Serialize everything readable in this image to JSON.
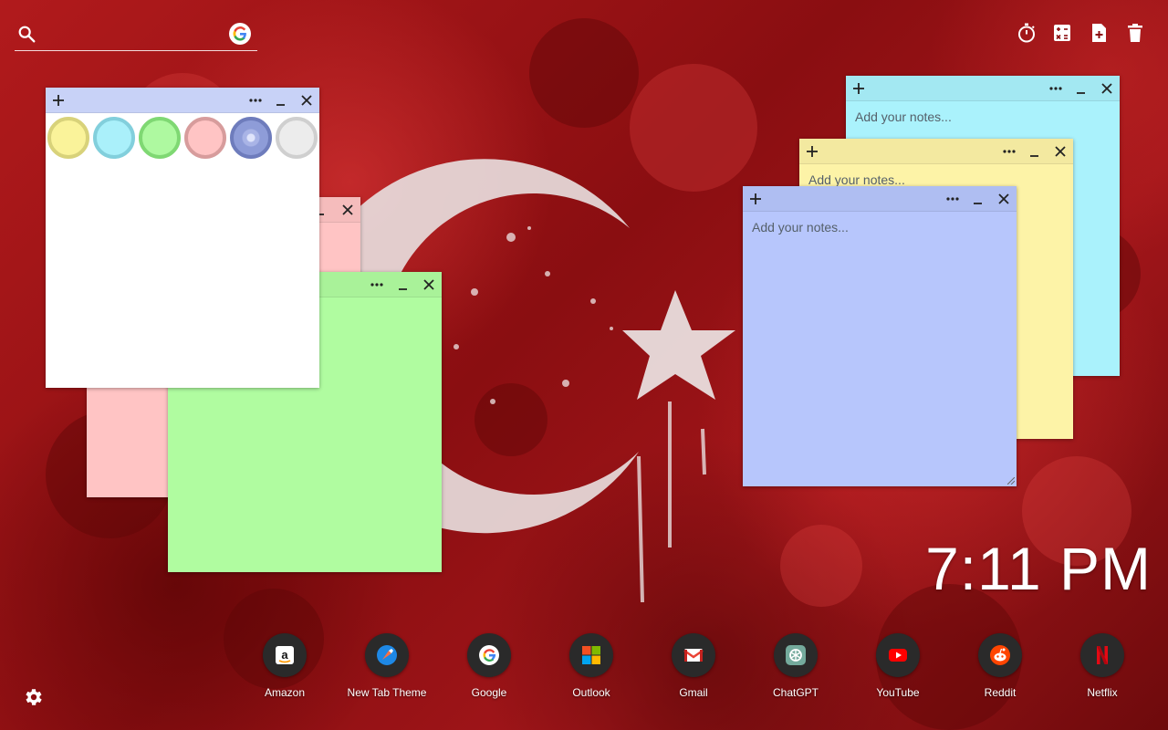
{
  "search": {
    "placeholder": "",
    "icon": "search-icon",
    "engine_icon": "google-icon"
  },
  "toolbar": {
    "tools": [
      {
        "name": "timer",
        "icon": "stopwatch-icon"
      },
      {
        "name": "calculator",
        "icon": "calculator-icon"
      },
      {
        "name": "new-note",
        "icon": "add-note-icon"
      },
      {
        "name": "delete",
        "icon": "trash-icon"
      }
    ]
  },
  "notes": [
    {
      "id": "white",
      "color": "#ffffff",
      "placeholder": "",
      "menu": "color-picker"
    },
    {
      "id": "pink",
      "color": "#ffc4c4",
      "placeholder": ""
    },
    {
      "id": "green",
      "color": "#b0fca0",
      "placeholder": ""
    },
    {
      "id": "cyan",
      "color": "#aaf2fc",
      "placeholder": "Add your notes..."
    },
    {
      "id": "yellow",
      "color": "#fdf3a7",
      "placeholder": "Add your notes..."
    },
    {
      "id": "blue",
      "color": "#b7c6fc",
      "placeholder": "Add your notes..."
    }
  ],
  "color_picker": {
    "swatches": [
      {
        "name": "yellow",
        "fill": "#faf39a",
        "ring": "#d8d27a"
      },
      {
        "name": "cyan",
        "fill": "#aaf0fa",
        "ring": "#82cfdc"
      },
      {
        "name": "green",
        "fill": "#aef9a0",
        "ring": "#7fd873"
      },
      {
        "name": "pink",
        "fill": "#ffc4c4",
        "ring": "#d79c9c"
      },
      {
        "name": "blue",
        "fill": "#8e9cd8",
        "ring": "#6e7cbc"
      },
      {
        "name": "white",
        "fill": "#ececec",
        "ring": "#cfcfcf"
      }
    ]
  },
  "clock": {
    "time": "7:11 PM"
  },
  "shortcuts": [
    {
      "label": "Amazon",
      "icon": "amazon-icon"
    },
    {
      "label": "New Tab Theme",
      "icon": "new-tab-theme-icon"
    },
    {
      "label": "Google",
      "icon": "google-icon"
    },
    {
      "label": "Outlook",
      "icon": "outlook-icon"
    },
    {
      "label": "Gmail",
      "icon": "gmail-icon"
    },
    {
      "label": "ChatGPT",
      "icon": "chatgpt-icon"
    },
    {
      "label": "YouTube",
      "icon": "youtube-icon"
    },
    {
      "label": "Reddit",
      "icon": "reddit-icon"
    },
    {
      "label": "Netflix",
      "icon": "netflix-icon"
    }
  ],
  "settings": {
    "icon": "gear-icon"
  }
}
